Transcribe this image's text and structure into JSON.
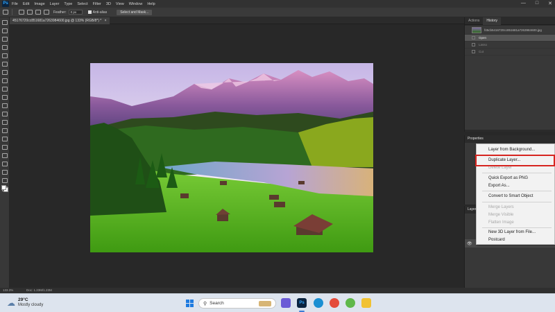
{
  "app": {
    "logo_text": "Ps"
  },
  "menubar": {
    "items": [
      "File",
      "Edit",
      "Image",
      "Layer",
      "Type",
      "Select",
      "Filter",
      "3D",
      "View",
      "Window",
      "Help"
    ],
    "window_controls": {
      "minimize": "—",
      "maximize": "□",
      "close": "✕"
    }
  },
  "options_bar": {
    "feather_label": "Feather:",
    "feather_value": "0 px",
    "antialias_label": "Anti-alias",
    "select_mask_label": "Select and Mask..."
  },
  "document_tab": {
    "title": "45176720cc851681a7263984600.jpg @ 133% (RGB/8*) *",
    "close": "×"
  },
  "right_panel": {
    "tabs": [
      "Actions",
      "History"
    ],
    "active_tab": "History",
    "history": {
      "snapshot_name": "f45cb5416720cc851681a7263984600.jpg",
      "states": [
        "Open",
        "Lasso",
        "Cut"
      ]
    },
    "properties_header": "Properties",
    "layers_header": "Layers"
  },
  "context_menu": {
    "items": [
      {
        "label": "Layer from Background...",
        "disabled": false
      },
      {
        "label": "Duplicate Layer...",
        "disabled": false,
        "highlighted": true
      },
      {
        "label": "Delete Layer",
        "disabled": true
      },
      {
        "label": "Quick Export as PNG",
        "disabled": false
      },
      {
        "label": "Export As...",
        "disabled": false
      },
      {
        "label": "Convert to Smart Object",
        "disabled": false
      },
      {
        "label": "Merge Layers",
        "disabled": true
      },
      {
        "label": "Merge Visible",
        "disabled": true
      },
      {
        "label": "Flatten Image",
        "disabled": true
      },
      {
        "label": "New 3D Layer from File...",
        "disabled": false
      },
      {
        "label": "Postcard",
        "disabled": false
      }
    ],
    "highlight_color": "#d6241f"
  },
  "status_bar": {
    "zoom": "133.3%",
    "doc_info": "Doc: 1.23M/1.23M"
  },
  "taskbar": {
    "weather_temp": "29°C",
    "weather_desc": "Mostly cloudy",
    "search_placeholder": "Search"
  }
}
